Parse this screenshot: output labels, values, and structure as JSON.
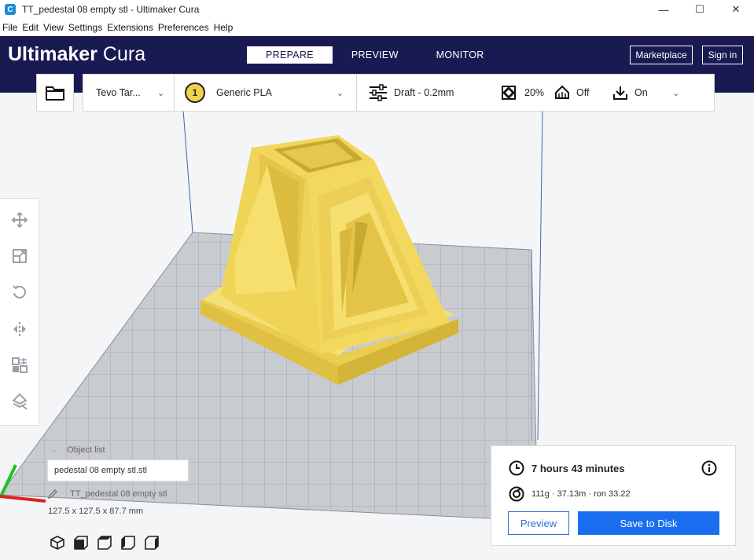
{
  "window": {
    "title": "TT_pedestal 08 empty stl - Ultimaker Cura",
    "app_icon": "C",
    "minimize_glyph": "—",
    "maximize_glyph": "☐",
    "close_glyph": "✕"
  },
  "menu": {
    "items": [
      "File",
      "Edit",
      "View",
      "Settings",
      "Extensions",
      "Preferences",
      "Help"
    ]
  },
  "header": {
    "brand_main": "Ultimaker",
    "brand_sub": "Cura",
    "tabs": [
      {
        "label": "PREPARE",
        "active": true
      },
      {
        "label": "PREVIEW",
        "active": false
      },
      {
        "label": "MONITOR",
        "active": false
      }
    ],
    "marketplace_label": "Marketplace",
    "signin_label": "Sign in"
  },
  "toolbar": {
    "printer": "Tevo Tar...",
    "extruder_number": "1",
    "material": "Generic PLA",
    "profile": "Draft - 0.2mm",
    "infill": "20%",
    "support": "Off",
    "adhesion": "On"
  },
  "objects": {
    "title": "Object list",
    "selected_file": "pedestal 08 empty stl.stl",
    "object_name": "TT_pedestal 08 empty stl",
    "dimensions": "127.5 x 127.5 x 87.7 mm"
  },
  "print_summary": {
    "time": "7 hours 43 minutes",
    "material_usage": "111g · 37.13m · ron 33.22",
    "preview_label": "Preview",
    "save_label": "Save to Disk"
  },
  "colors": {
    "header_bg": "#1a1a53",
    "accent_blue": "#196ef0",
    "model_yellow": "#f3d75a"
  }
}
